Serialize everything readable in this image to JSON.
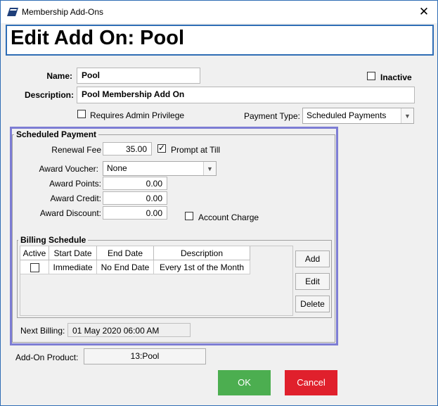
{
  "window": {
    "title": "Membership Add-Ons",
    "close_glyph": "✕",
    "heading": "Edit Add On: Pool"
  },
  "form": {
    "name_label": "Name:",
    "name_value": "Pool",
    "inactive_label": "Inactive",
    "inactive_checked": false,
    "description_label": "Description:",
    "description_value": "Pool Membership Add On",
    "requires_admin_label": "Requires Admin Privilege",
    "requires_admin_checked": false,
    "payment_type_label": "Payment Type:",
    "payment_type_value": "Scheduled Payments"
  },
  "scheduled_payment": {
    "legend": "Scheduled Payment",
    "renewal_fee_label": "Renewal Fee",
    "renewal_fee_value": "35.00",
    "prompt_at_till_label": "Prompt at Till",
    "prompt_at_till_checked": true,
    "award_voucher_label": "Award Voucher:",
    "award_voucher_value": "None",
    "award_points_label": "Award Points:",
    "award_points_value": "0.00",
    "award_credit_label": "Award Credit:",
    "award_credit_value": "0.00",
    "award_discount_label": "Award Discount:",
    "award_discount_value": "0.00",
    "account_charge_label": "Account Charge",
    "account_charge_checked": false,
    "next_billing_label": "Next Billing:",
    "next_billing_value": "01 May 2020 06:00 AM"
  },
  "billing_schedule": {
    "legend": "Billing Schedule",
    "columns": [
      "Active",
      "Start Date",
      "End Date",
      "Description"
    ],
    "rows": [
      {
        "active": false,
        "start_date": "Immediate",
        "end_date": "No End Date",
        "description": "Every 1st of the Month"
      }
    ],
    "add_label": "Add",
    "edit_label": "Edit",
    "delete_label": "Delete"
  },
  "addon_product": {
    "label": "Add-On Product:",
    "value": "13:Pool"
  },
  "footer": {
    "ok_label": "OK",
    "cancel_label": "Cancel"
  },
  "colors": {
    "accent_blue": "#2f6db5",
    "highlight_border": "#7d7dd4",
    "ok_green": "#4cae50",
    "cancel_red": "#e0202c"
  },
  "icons": {
    "app": "membership-card-icon",
    "close": "close-icon",
    "dropdown": "chevron-down-icon"
  }
}
